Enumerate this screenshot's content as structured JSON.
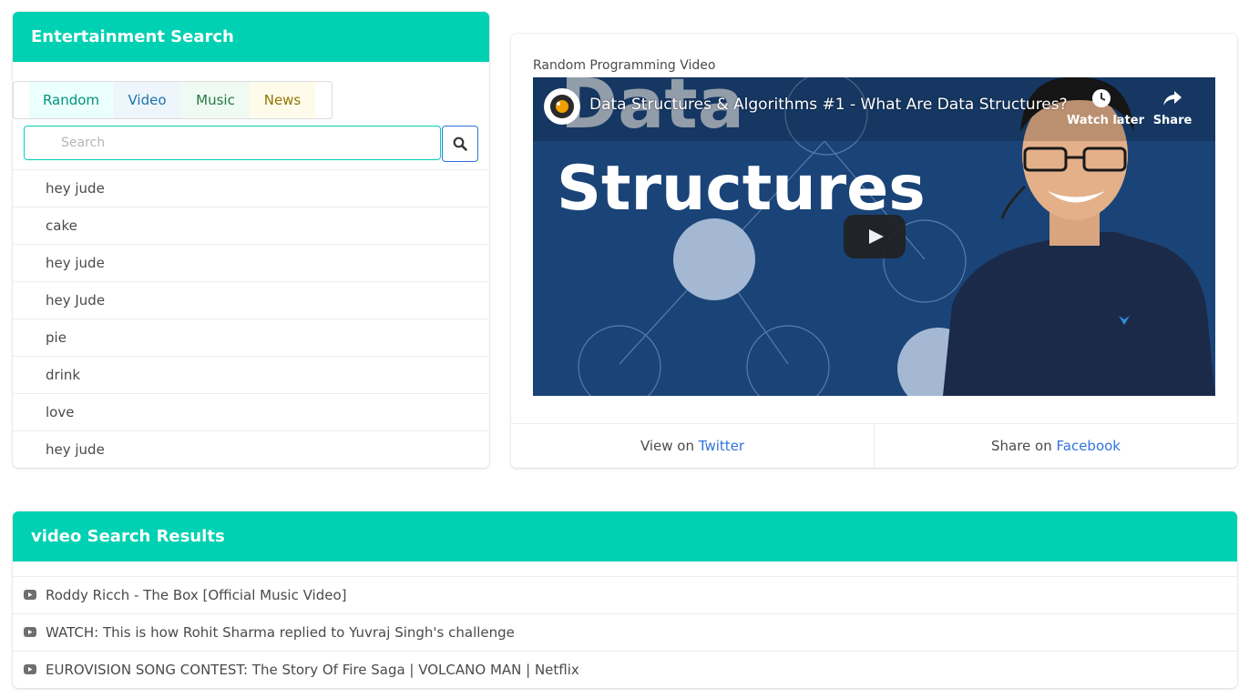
{
  "search_panel": {
    "title": "Entertainment Search",
    "tabs": [
      "Random",
      "Video",
      "Music",
      "News"
    ],
    "search_placeholder": "Search",
    "history": [
      "hey jude",
      "cake",
      "hey jude",
      "hey Jude",
      "pie",
      "drink",
      "love",
      "hey jude"
    ]
  },
  "video_panel": {
    "label": "Random Programming Video",
    "player": {
      "video_title": "Data Structures & Algorithms #1 - What Are Data Structures?",
      "watch_later": "Watch later",
      "share": "Share",
      "thumbnail_text_top": "Data",
      "thumbnail_text_main": "Structures"
    },
    "footer": {
      "twitter_prefix": "View on",
      "twitter_link": "Twitter",
      "facebook_prefix": "Share on",
      "facebook_link": "Facebook"
    }
  },
  "results_panel": {
    "title": "video Search Results",
    "items": [
      "Roddy Ricch - The Box [Official Music Video]",
      "WATCH: This is how Rohit Sharma replied to Yuvraj Singh's challenge",
      "EUROVISION SONG CONTEST: The Story Of Fire Saga | VOLCANO MAN | Netflix"
    ]
  },
  "colors": {
    "accent": "#00d1b2",
    "link": "#3273dc"
  }
}
